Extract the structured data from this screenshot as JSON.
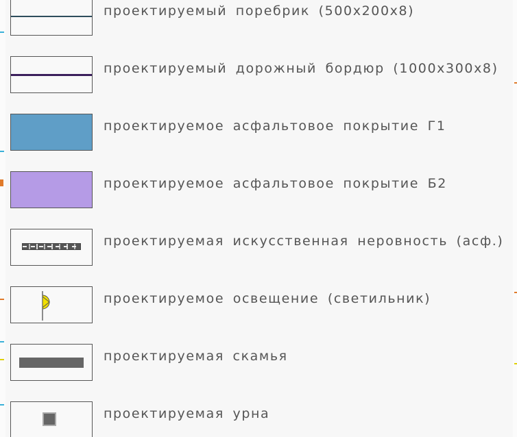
{
  "legend": {
    "items": [
      {
        "label": "проектируемый поребрик (500х200х8)",
        "symbol": "line",
        "color": "#2e4d5c"
      },
      {
        "label": "проектируемый дорожный бордюр (1000х300х8)",
        "symbol": "line",
        "color": "#3b1f5c"
      },
      {
        "label": "проектируемое асфальтовое покрытие Г1",
        "symbol": "fill",
        "color": "#5f9ec7"
      },
      {
        "label": "проектируемое асфальтовое покрытие Б2",
        "symbol": "fill",
        "color": "#b59be6"
      },
      {
        "label": "проектируемая искусственная неровность (асф.)",
        "symbol": "speed-hump-icon"
      },
      {
        "label": "проектируемое освещение (светильник)",
        "symbol": "street-light-icon",
        "color": "#f2e000"
      },
      {
        "label": "проектируемая скамья",
        "symbol": "bench-icon"
      },
      {
        "label": "проектируемая урна",
        "symbol": "urn-icon"
      }
    ]
  }
}
